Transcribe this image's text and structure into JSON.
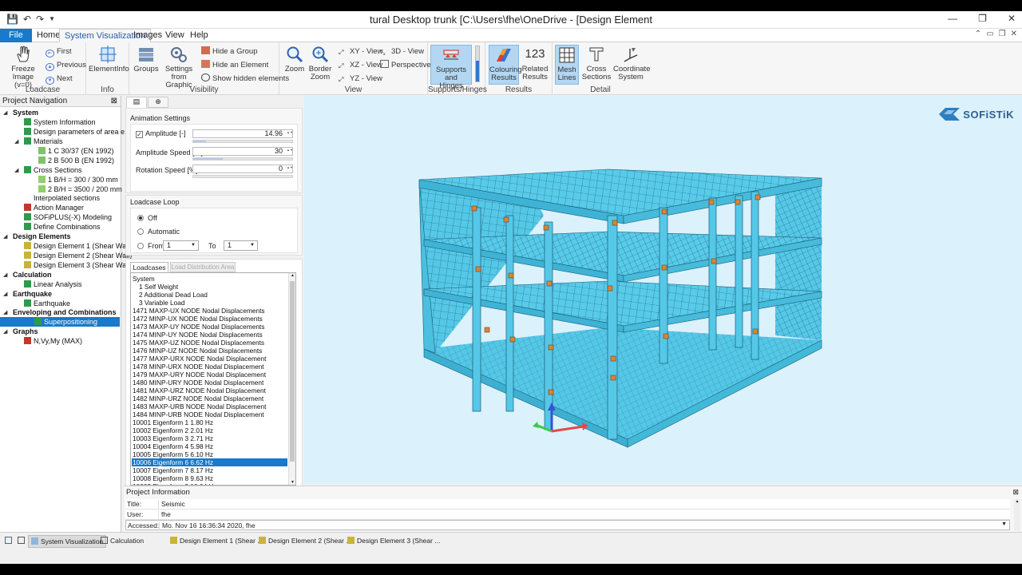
{
  "title_bar": {
    "title": "tural Desktop trunk  [C:\\Users\\fhe\\OneDrive - [Design Element"
  },
  "menu": {
    "file": "File",
    "home": "Home",
    "system_visualization": "System Visualization",
    "images": "Images",
    "view": "View",
    "help": "Help"
  },
  "ribbon": {
    "loadcase": {
      "label": "Loadcase",
      "freeze_image": "Freeze Image",
      "freeze_sub": "(v=0)",
      "first": "First",
      "previous": "Previous",
      "next": "Next"
    },
    "info": {
      "label": "Info",
      "element_info": "ElementInfo"
    },
    "visibility": {
      "label": "Visibility",
      "groups": "Groups",
      "settings_from": "Settings from",
      "graphic": "Graphic",
      "hide_group": "Hide a Group",
      "hide_element": "Hide an Element",
      "show_hidden": "Show hidden elements"
    },
    "view": {
      "label": "View",
      "zoom": "Zoom",
      "border": "Border",
      "border_zoom": "Zoom",
      "xy_view": "XY - View",
      "xz_view": "XZ - View",
      "yz_view": "YZ - View",
      "view_3d": "3D - View",
      "perspective": "Perspective"
    },
    "supports": {
      "label": "Supports/Hinges",
      "btn1": "Supports and",
      "btn2": "Hinges"
    },
    "results": {
      "label": "Results",
      "colouring1": "Colouring",
      "colouring2": "Results",
      "related1": "Related",
      "related2": "Results",
      "related_icon_text": "123"
    },
    "detail": {
      "label": "Detail",
      "mesh1": "Mesh",
      "mesh2": "Lines",
      "cross1": "Cross",
      "cross2": "Sections",
      "coord1": "Coordinate",
      "coord2": "System"
    }
  },
  "nav": {
    "title": "Project Navigation",
    "items": [
      {
        "label": "System"
      },
      {
        "label": "System Information"
      },
      {
        "label": "Design parameters of area e..."
      },
      {
        "label": "Materials"
      },
      {
        "label": "1 C 30/37 (EN 1992)"
      },
      {
        "label": "2 B 500 B (EN 1992)"
      },
      {
        "label": "Cross Sections"
      },
      {
        "label": "1 B/H = 300 / 300 mm"
      },
      {
        "label": "2 B/H = 3500 / 200 mm"
      },
      {
        "label": "Interpolated sections"
      },
      {
        "label": "Action Manager"
      },
      {
        "label": "SOFiPLUS(-X) Modeling"
      },
      {
        "label": "Define Combinations"
      },
      {
        "label": "Design Elements"
      },
      {
        "label": "Design Element 1 (Shear Wall)"
      },
      {
        "label": "Design Element 2 (Shear Wall)"
      },
      {
        "label": "Design Element 3 (Shear Wall)"
      },
      {
        "label": "Calculation"
      },
      {
        "label": "Linear Analysis"
      },
      {
        "label": "Earthquake"
      },
      {
        "label": "Earthquake"
      },
      {
        "label": "Enveloping and Combinations"
      },
      {
        "label": "Superpositioning"
      },
      {
        "label": "Graphs"
      },
      {
        "label": "N,Vy,My (MAX)"
      }
    ]
  },
  "settings": {
    "animation_title": "Animation Settings",
    "amplitude_label": "Amplitude [-]",
    "amplitude_value": "14.96",
    "amplitude_level": 0.13,
    "amplitude_speed_label": "Amplitude Speed [%]",
    "amplitude_speed_value": "30",
    "amplitude_speed_level": 0.3,
    "rotation_speed_label": "Rotation Speed [%]",
    "rotation_speed_value": "0",
    "rotation_speed_level": 0,
    "loop_title": "Loadcase Loop",
    "off": "Off",
    "automatic": "Automatic",
    "from": "From",
    "from_value": "1",
    "to": "To",
    "to_value": "1",
    "tab_loadcases": "Loadcases",
    "tab_load_distribution": "Load Distribution Area"
  },
  "loadcases": [
    "System",
    "1 Self Weight",
    "2 Additional Dead Load",
    "3 Variable Load",
    "1471 MAXP-UX NODE Nodal Displacements",
    "1472 MINP-UX NODE Nodal Displacements",
    "1473 MAXP-UY NODE Nodal Displacements",
    "1474 MINP-UY NODE Nodal Displacements",
    "1475 MAXP-UZ NODE Nodal Displacements",
    "1476 MINP-UZ NODE Nodal Displacements",
    "1477 MAXP-URX NODE Nodal Displacement",
    "1478 MINP-URX NODE Nodal Displacement",
    "1479 MAXP-URY NODE Nodal Displacement",
    "1480 MINP-URY NODE Nodal Displacement",
    "1481 MAXP-URZ NODE Nodal Displacement",
    "1482 MINP-URZ NODE Nodal Displacement",
    "1483 MAXP-URB NODE Nodal Displacement",
    "1484 MINP-URB NODE Nodal Displacement",
    "10001 Eigenform  1     1.80 Hz",
    "10002 Eigenform  2     2.01 Hz",
    "10003 Eigenform  3     2.71 Hz",
    "10004 Eigenform  4     5.98 Hz",
    "10005 Eigenform  5     6.10 Hz",
    "10006 Eigenform  6     6.62 Hz",
    "10007 Eigenform  7     8.17 Hz",
    "10008 Eigenform  8     9.63 Hz",
    "10009 Eigenform  9    10.04 Hz"
  ],
  "viewport": {
    "logo": "SOFiSTiK"
  },
  "project_info": {
    "title": "Project Information",
    "rows": [
      {
        "key": "Title:",
        "value": "Seismic"
      },
      {
        "key": "User:",
        "value": "fhe"
      },
      {
        "key": "Accessed:",
        "value": "Mo. Nov 16 16:36:34 2020, fhe"
      }
    ]
  },
  "taskbar": {
    "items": [
      "System Visualization",
      "Calculation",
      "Design Element 1 (Shear ...",
      "Design Element 2 (Shear ...",
      "Design Element 3 (Shear ..."
    ]
  },
  "colors": {
    "accent": "#1979ca",
    "model": "#55c8e8",
    "background": "#dbf1fc"
  }
}
